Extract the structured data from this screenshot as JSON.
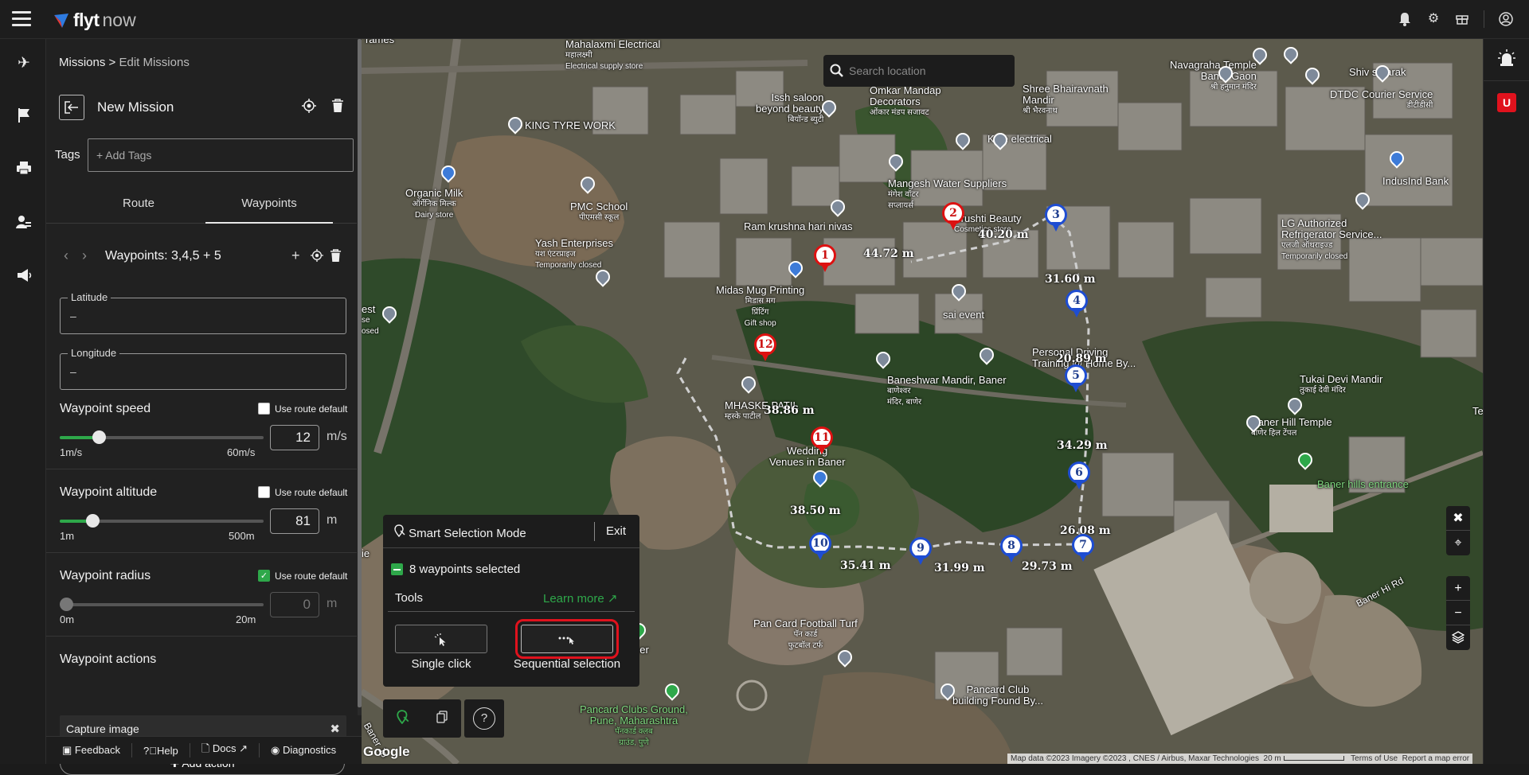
{
  "app": {
    "logo_fly": "flyt",
    "logo_now": "now"
  },
  "topbar": {
    "icons": [
      "bell-icon",
      "gear-icon",
      "gift-icon",
      "account-icon"
    ]
  },
  "rail": {
    "icons": [
      "plane-icon",
      "flag-icon",
      "printer-icon",
      "users-icon",
      "megaphone-icon"
    ]
  },
  "breadcrumb": {
    "root": "Missions",
    "separator": ">",
    "current": "Edit Missions"
  },
  "mission": {
    "title": "New Mission"
  },
  "tags": {
    "label": "Tags",
    "placeholder": "+ Add Tags"
  },
  "tabs": [
    {
      "label": "Route",
      "active": false
    },
    {
      "label": "Waypoints",
      "active": true
    }
  ],
  "waypoints_header": {
    "title": "Waypoints: 3,4,5 + 5"
  },
  "latitude": {
    "label": "Latitude",
    "value": "–"
  },
  "longitude": {
    "label": "Longitude",
    "value": "–"
  },
  "speed": {
    "title": "Waypoint speed",
    "use_default_label": "Use route default",
    "use_default": false,
    "value": "12",
    "unit": "m/s",
    "min_label": "1m/s",
    "max_label": "60m/s",
    "fraction": 0.19
  },
  "altitude": {
    "title": "Waypoint altitude",
    "use_default_label": "Use route default",
    "use_default": false,
    "value": "81",
    "unit": "m",
    "min_label": "1m",
    "max_label": "500m",
    "fraction": 0.16
  },
  "radius": {
    "title": "Waypoint radius",
    "use_default_label": "Use route default",
    "use_default": true,
    "value": "0",
    "unit": "m",
    "min_label": "0m",
    "max_label": "20m",
    "fraction": 0
  },
  "actions": {
    "title": "Waypoint actions",
    "items": [
      "Capture image"
    ],
    "add_label": "Add action"
  },
  "footer": {
    "feedback": "Feedback",
    "help": "Help",
    "docs": "Docs",
    "diagnostics": "Diagnostics"
  },
  "map": {
    "search_placeholder": "Search location",
    "labels": {
      "mahalaxmi": "Mahalaxmi Electrical",
      "mahalaxmi_sub1": "महालक्ष्मी",
      "mahalaxmi_sub2": "Electrical supply store",
      "frames": "rames",
      "issh": "Issh saloon",
      "issh2": "beyond beauty",
      "issh3": "बियॉन्ड ब्युटी",
      "omkar": "Omkar Mandap",
      "omkar2": "Decorators",
      "omkar3": "ओंकार मंडप सजावट",
      "bhairavnath": "Shree Bhairavnath",
      "bhairavnath2": "Mandir",
      "bhairavnath3": "श्री भैरवनाथ",
      "navagraha": "Navagraha Temple",
      "navagraha2": "Baner Gaon",
      "navagraha3": "श्री हनुमान मंदिर",
      "shiv": "Shiv smarak",
      "dtdc": "DTDC Courier Service",
      "dtdc2": "डीटीडीसी",
      "kingtyre": "KING TYRE WORK",
      "kale": "Kale electrical",
      "organic": "Organic Milk",
      "organic2": "ऑर्गेनिक मिल्क",
      "organic3": "Dairy store",
      "pmc": "PMC School",
      "pmc2": "पीएमसी स्कूल",
      "mangesh": "Mangesh Water Suppliers",
      "mangesh2": "मंगेश वॉटर",
      "mangesh3": "सप्लायर्स",
      "indusind": "IndusInd Bank",
      "srushti": "Srushti Beauty",
      "srushti2": "Cosmetics store",
      "ramkrushna": "Ram krushna hari nivas",
      "lg": "LG Authorized",
      "lg2": "Refrigerator Service...",
      "lg3": "एलजी ऑथराइज्ड",
      "lg4": "Temporarily closed",
      "yash": "Yash Enterprises",
      "yash2": "यश एंटरप्राइज",
      "yash3": "Temporarily closed",
      "midas": "Midas Mug Printing",
      "midas2": "मिडास मग",
      "midas3": "प्रिंटिंग",
      "midas4": "Gift shop",
      "saievent": "sai event",
      "est": "est",
      "est2": "se",
      "est3": "osed",
      "personal": "Personal Driving",
      "personal2": "Training @ Home By...",
      "baneshwar": "Baneshwar Mandir, Baner",
      "baneshwar2": "बाणेश्वर",
      "baneshwar3": "मंदिर, बाणेर",
      "mhaske": "MHASKE PATIL",
      "mhaske2": "म्हस्के पाटील",
      "wedding": "Wedding",
      "wedding2": "Venues in Baner",
      "tukai": "Tukai Devi Mandir",
      "tukai2": "तुकाई देवी मंदिर",
      "banerhill": "Baner Hill Temple",
      "banerhill2": "बाणेर हिल टेंपल",
      "banerhills": "Baner hills entrance",
      "te": "Te",
      "ie": "ie",
      "pancard": "Pan Card Football Turf",
      "pancard2": "पॅन कार्ड",
      "pancard3": "फुटबॉल टर्फ",
      "pancardclub": "Pancard Club",
      "pancardclub2": "building Found By...",
      "pancardclubs": "Pancard Clubs Ground,",
      "pancardclubs2": "Pune, Maharashtra",
      "pancardclubs3": "पॅनकार्ड क्लब",
      "pancardclubs4": "ग्राउंड, पुणे",
      "ner": "ner",
      "banerhi": "Baner Hi Rd",
      "baner_jupiter": "Baner Jo"
    },
    "waypoints": [
      {
        "n": "1",
        "color": "red"
      },
      {
        "n": "2",
        "color": "red"
      },
      {
        "n": "3",
        "color": "blue"
      },
      {
        "n": "4",
        "color": "blue"
      },
      {
        "n": "5",
        "color": "blue"
      },
      {
        "n": "6",
        "color": "blue"
      },
      {
        "n": "7",
        "color": "blue"
      },
      {
        "n": "8",
        "color": "blue"
      },
      {
        "n": "9",
        "color": "blue"
      },
      {
        "n": "10",
        "color": "blue"
      },
      {
        "n": "11",
        "color": "red"
      },
      {
        "n": "12",
        "color": "red"
      }
    ],
    "distances": [
      "44.72 m",
      "40.20 m",
      "31.60 m",
      "20.89 m",
      "34.29 m",
      "26.08 m",
      "29.73 m",
      "31.99 m",
      "35.41 m",
      "38.50 m",
      "38.86 m"
    ],
    "attribution": "Map data ©2023 Imagery ©2023 , CNES / Airbus, Maxar Technologies",
    "scale": "20 m",
    "terms": "Terms of Use",
    "report": "Report a map error",
    "google": "Google"
  },
  "smart_selection": {
    "title": "Smart Selection Mode",
    "exit": "Exit",
    "selected_text": "8 waypoints selected",
    "tools_label": "Tools",
    "learn_more": "Learn more",
    "single_click": "Single click",
    "sequential": "Sequential selection"
  },
  "colors": {
    "accent_green": "#2ea84a",
    "highlight_red": "#e0121d",
    "wp_blue": "#1e4dd2",
    "wp_red": "#d11111"
  }
}
